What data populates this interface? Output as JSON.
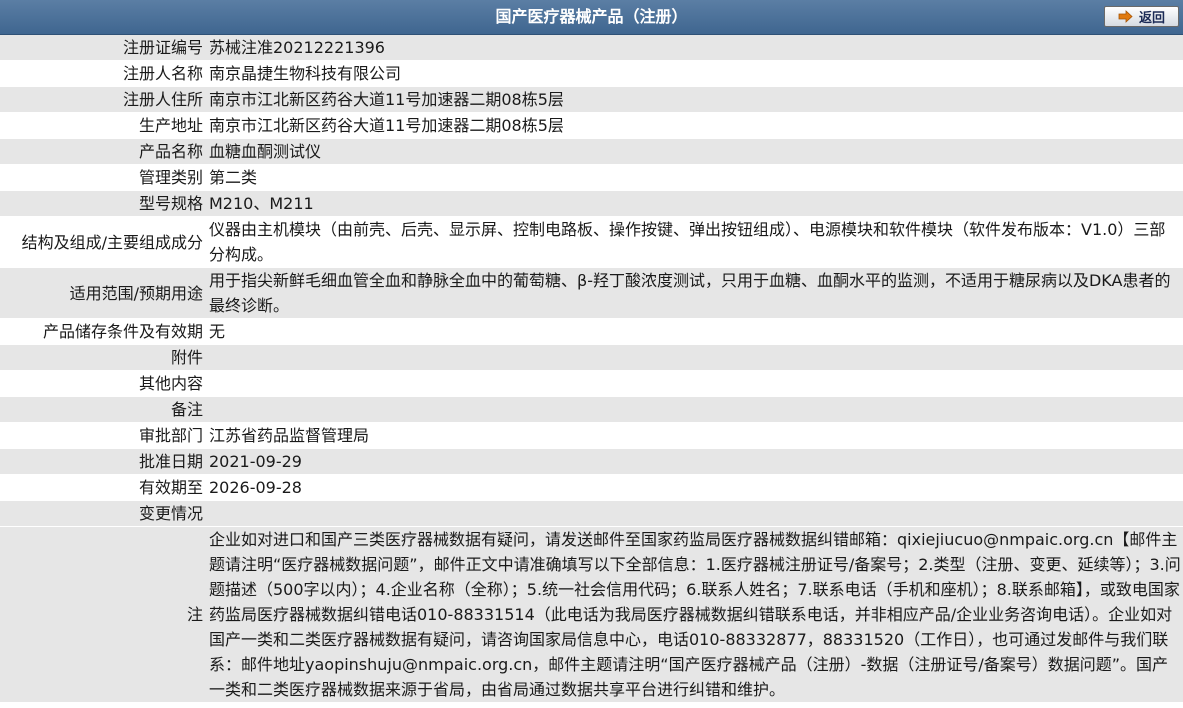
{
  "header": {
    "title": "国产医疗器械产品（注册）",
    "back_label": "返回"
  },
  "rows": [
    {
      "key": "注册证编号",
      "value": "苏械注准20212221396"
    },
    {
      "key": "注册人名称",
      "value": "南京晶捷生物科技有限公司"
    },
    {
      "key": "注册人住所",
      "value": "南京市江北新区药谷大道11号加速器二期08栋5层"
    },
    {
      "key": "生产地址",
      "value": "南京市江北新区药谷大道11号加速器二期08栋5层"
    },
    {
      "key": "产品名称",
      "value": "血糖血酮测试仪"
    },
    {
      "key": "管理类别",
      "value": "第二类"
    },
    {
      "key": "型号规格",
      "value": "M210、M211"
    },
    {
      "key": "结构及组成/主要组成成分",
      "value": "仪器由主机模块（由前壳、后壳、显示屏、控制电路板、操作按键、弹出按钮组成）、电源模块和软件模块（软件发布版本：V1.0）三部分构成。"
    },
    {
      "key": "适用范围/预期用途",
      "value": "用于指尖新鲜毛细血管全血和静脉全血中的葡萄糖、β-羟丁酸浓度测试，只用于血糖、血酮水平的监测，不适用于糖尿病以及DKA患者的最终诊断。"
    },
    {
      "key": "产品储存条件及有效期",
      "value": "无"
    },
    {
      "key": "附件",
      "value": ""
    },
    {
      "key": "其他内容",
      "value": ""
    },
    {
      "key": "备注",
      "value": ""
    },
    {
      "key": "审批部门",
      "value": "江苏省药品监督管理局"
    },
    {
      "key": "批准日期",
      "value": "2021-09-29"
    },
    {
      "key": "有效期至",
      "value": "2026-09-28"
    },
    {
      "key": "变更情况",
      "value": ""
    }
  ],
  "note": {
    "key": "注",
    "value": "企业如对进口和国产三类医疗器械数据有疑问，请发送邮件至国家药监局医疗器械数据纠错邮箱：qixiejiucuo@nmpaic.org.cn【邮件主题请注明“医疗器械数据问题”，邮件正文中请准确填写以下全部信息：1.医疗器械注册证号/备案号；2.类型（注册、变更、延续等）；3.问题描述（500字以内）；4.企业名称（全称）；5.统一社会信用代码；6.联系人姓名；7.联系电话（手机和座机）；8.联系邮箱】，或致电国家药监局医疗器械数据纠错电话010-88331514（此电话为我局医疗器械数据纠错联系电话，并非相应产品/企业业务咨询电话）。企业如对国产一类和二类医疗器械数据有疑问，请咨询国家局信息中心，电话010-88332877，88331520（工作日），也可通过发邮件与我们联系：邮件地址yaopinshuju@nmpaic.org.cn，邮件主题请注明“国产医疗器械产品（注册）-数据（注册证号/备案号）数据问题”。国产一类和二类医疗器械数据来源于省局，由省局通过数据共享平台进行纠错和维护。"
  },
  "icons": {
    "back": "arrow-right-icon"
  },
  "colors": {
    "header_bg": "#4a7099",
    "row_alt": "#e6e6e6",
    "arrow": "#e07a10"
  }
}
